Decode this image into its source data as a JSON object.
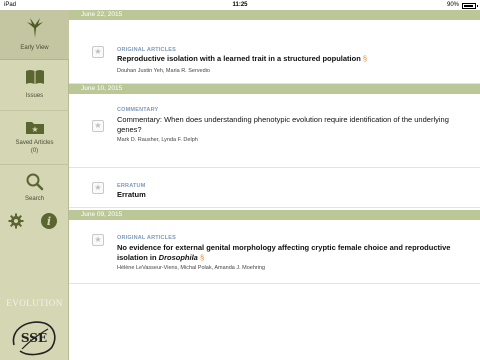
{
  "status": {
    "device": "iPad",
    "time": "11:25",
    "battery": "90%",
    "battery_level": 0.9
  },
  "sidebar": {
    "items": [
      {
        "label": "Early View",
        "icon": "early-view-icon"
      },
      {
        "label": "Issues",
        "icon": "book-icon"
      },
      {
        "label": "Saved Articles\n(0)",
        "icon": "saved-folder-icon"
      },
      {
        "label": "Search",
        "icon": "magnifier-icon"
      }
    ],
    "settings_icon": "gear-icon",
    "info_icon": "info-icon",
    "journal_title": "EVOLUTION",
    "logo_text": "SSE",
    "colors": {
      "sidebar_bg": "#d4d6b4",
      "accent": "#5c6b2e"
    }
  },
  "feed": {
    "sections": [
      {
        "date": "June 22, 2015",
        "articles": [
          {
            "category": "ORIGINAL ARTICLES",
            "title": "Reproductive isolation with a learned trait in a structured population",
            "authors": "Douhan Justin Yeh, Maria R. Servedio"
          }
        ]
      },
      {
        "date": "June 10, 2015",
        "articles": [
          {
            "category": "COMMENTARY",
            "title": "Commentary: When does understanding phenotypic evolution require identification of the underlying genes?",
            "authors": "Mark D. Rausher, Lynda F. Delph"
          },
          {
            "category": "ERRATUM",
            "title": "Erratum",
            "authors": ""
          }
        ]
      },
      {
        "date": "June 09, 2015",
        "articles": [
          {
            "category": "ORIGINAL ARTICLES",
            "title": "No evidence for external genital morphology affecting cryptic female choice and reproductive isolation in ",
            "title_italic": "Drosophila",
            "authors": "Hélène LeVasseur-Viens, Michal Polak, Amanda J. Moehring"
          }
        ]
      }
    ],
    "lock_glyph": "§",
    "star_glyph": "★",
    "colors": {
      "date_bar": "#bcc798",
      "category": "#7f9aba",
      "lock": "#e98a2b"
    }
  }
}
